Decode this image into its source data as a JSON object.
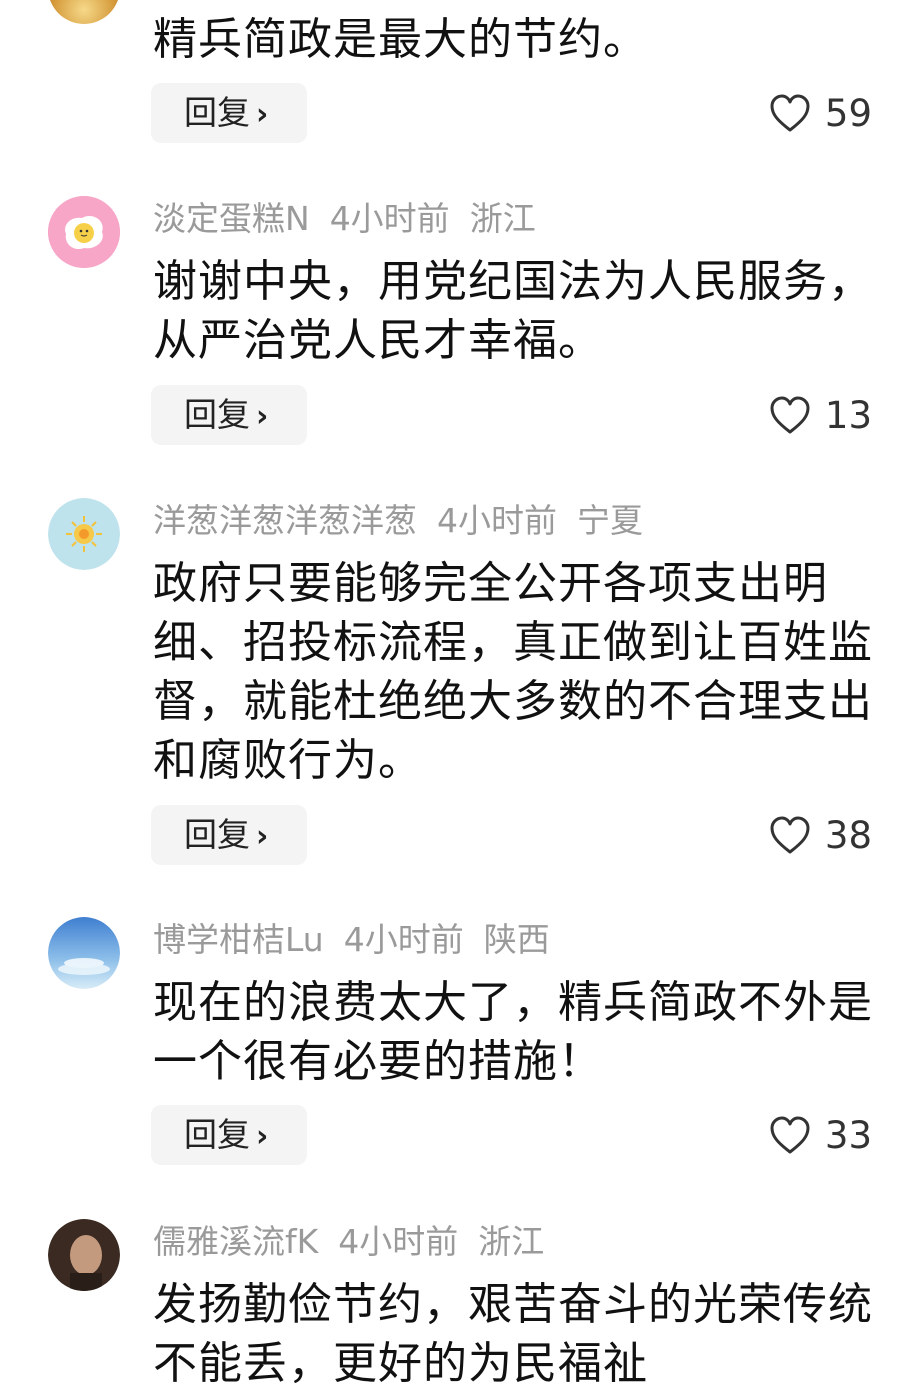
{
  "comments": [
    {
      "username": "",
      "time": "",
      "location": "",
      "text": "精兵简政是最大的节约。",
      "reply_label": "回复",
      "likes": "59"
    },
    {
      "username": "淡定蛋糕N",
      "time": "4小时前",
      "location": "浙江",
      "text": "谢谢中央，用党纪国法为人民服务，从严治党人民才幸福。",
      "reply_label": "回复",
      "likes": "13"
    },
    {
      "username": "洋葱洋葱洋葱洋葱",
      "time": "4小时前",
      "location": "宁夏",
      "text": "政府只要能够完全公开各项支出明细、招投标流程，真正做到让百姓监督，就能杜绝绝大多数的不合理支出和腐败行为。",
      "reply_label": "回复",
      "likes": "38"
    },
    {
      "username": "博学柑桔Lu",
      "time": "4小时前",
      "location": "陕西",
      "text": "现在的浪费太大了，精兵简政不外是一个很有必要的措施！",
      "reply_label": "回复",
      "likes": "33"
    },
    {
      "username": "儒雅溪流fK",
      "time": "4小时前",
      "location": "浙江",
      "text": "发扬勤俭节约，艰苦奋斗的光荣传统不能丢，更好的为民福祉",
      "reply_label": "",
      "likes": ""
    }
  ],
  "icons": {
    "like": "heart-outline-icon",
    "reply_arrow": "chevron-right-icon"
  },
  "colors": {
    "meta_text": "#9a9a9a",
    "reply_bg": "#f4f4f4"
  }
}
